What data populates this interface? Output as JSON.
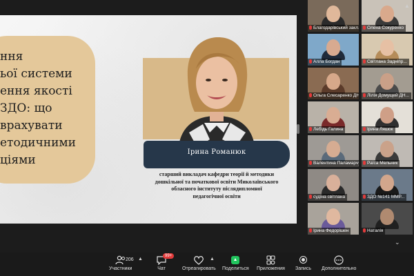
{
  "slide": {
    "title_lines": [
      "ння",
      "ьої системи",
      "ення якості",
      "ЗДО: що",
      "врахувати",
      "етодичними",
      "ціями"
    ],
    "presenter_name": "Ірина Романюк",
    "presenter_desc": [
      "старший викладач кафедри теорії й методики",
      "дошкільної та початкової освіти Миколаївського",
      "обласного інституту післядипломної",
      "педагогічної освіти"
    ]
  },
  "gallery": {
    "participants": [
      {
        "name": "Благодарівський закл...",
        "bg": "#7a6a5a",
        "face": "#e0b89a",
        "body": "#2b2b2b"
      },
      {
        "name": "Олена Сокуренко",
        "bg": "#c9c2b8",
        "face": "#d9a98c",
        "body": "#3a3a3a"
      },
      {
        "name": "Алла Богдан",
        "bg": "#7fa8c9",
        "face": "#d8aa90",
        "body": "#1f2a3a"
      },
      {
        "name": "Світлана Задніпр...",
        "bg": "#d8c9b0",
        "face": "#e6c0a4",
        "body": "#b58c5a"
      },
      {
        "name": "Ольга Слесаренко ДН...",
        "bg": "#8a6b52",
        "face": "#d7a88a",
        "body": "#5b3b2a"
      },
      {
        "name": "Лілія Домущей ДН...",
        "bg": "#a39c91",
        "face": "#caa088",
        "body": "#4a4a4a"
      },
      {
        "name": "Лебідь Галина",
        "bg": "#b9b2a8",
        "face": "#d9ad93",
        "body": "#7a2a2a"
      },
      {
        "name": "Ірина Ляшок",
        "bg": "#e4e0d8",
        "face": "#cf9f87",
        "body": "#2f2f2f"
      },
      {
        "name": "Валентина Паламарчук",
        "bg": "#9e9a95",
        "face": "#d6ac92",
        "body": "#5a6a7a"
      },
      {
        "name": "Раїса Мельник",
        "bg": "#bfbab4",
        "face": "#caa28a",
        "body": "#3a3a3a"
      },
      {
        "name": "судіна світлана",
        "bg": "#8f8a85",
        "face": "#d9b09a",
        "body": "#2a2a2a"
      },
      {
        "name": "ЗДО №141 ММР...",
        "bg": "#6b7a8a",
        "face": "#d2a68c",
        "body": "#1a1a1a"
      },
      {
        "name": "Ірина Федорішен",
        "bg": "#a9a39b",
        "face": "#e0b89f",
        "body": "#6a5a9a"
      },
      {
        "name": "Наталія",
        "bg": "#4a4a4a",
        "face": "#b08a70",
        "body": "#202020"
      }
    ]
  },
  "toolbar": {
    "participants_label": "Участники",
    "participants_count": "206",
    "chat_label": "Чат",
    "chat_badge": "99+",
    "react_label": "Отреагировать",
    "share_label": "Поделиться",
    "apps_label": "Приложения",
    "record_label": "Запись",
    "more_label": "Дополнительно"
  },
  "colors": {
    "slide_pill": "#e4c89a",
    "name_bar": "#26374a",
    "share_button": "#22c55e",
    "muted_mic": "#e23b3b"
  }
}
